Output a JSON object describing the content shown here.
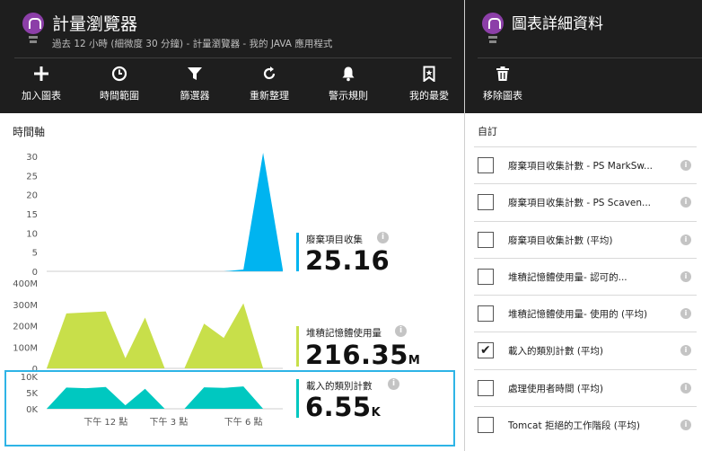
{
  "left_blade": {
    "title": "計量瀏覽器",
    "subtitle": "過去 12 小時 (細微度 30 分鐘) - 計量瀏覽器 - 我的 JAVA 應用程式",
    "toolbar": [
      {
        "icon": "plus-icon",
        "label": "加入圖表"
      },
      {
        "icon": "clock-icon",
        "label": "時間範圍"
      },
      {
        "icon": "filter-icon",
        "label": "篩選器"
      },
      {
        "icon": "refresh-icon",
        "label": "重新整理"
      },
      {
        "icon": "bell-icon",
        "label": "警示規則"
      },
      {
        "icon": "bookmark-icon",
        "label": "我的最愛"
      }
    ],
    "section_title": "時間軸"
  },
  "right_blade": {
    "title": "圖表詳細資料",
    "toolbar": [
      {
        "icon": "trash-icon",
        "label": "移除圖表"
      }
    ],
    "custom_label": "自訂",
    "metrics": [
      {
        "label": "廢棄項目收集計數 - PS MarkSw...",
        "checked": false
      },
      {
        "label": "廢棄項目收集計數 - PS Scaven...",
        "checked": false
      },
      {
        "label": "廢棄項目收集計數 (平均)",
        "checked": false
      },
      {
        "label": "堆積記憶體使用量- 認可的...",
        "checked": false
      },
      {
        "label": "堆積記憶體使用量- 使用的 (平均)",
        "checked": false
      },
      {
        "label": "載入的類別計數 (平均)",
        "checked": true
      },
      {
        "label": "處理使用者時間 (平均)",
        "checked": false
      },
      {
        "label": "Tomcat 拒絕的工作階段 (平均)",
        "checked": false
      }
    ]
  },
  "summaries": [
    {
      "name": "廢棄項目收集",
      "value": "25.16",
      "unit": "",
      "color": "#00b4f0"
    },
    {
      "name": "堆積記憶體使用量",
      "value": "216.35",
      "unit": "M",
      "color": "#c8df4a"
    },
    {
      "name": "載入的類別計數",
      "value": "6.55",
      "unit": "K",
      "color": "#00c8c0"
    }
  ],
  "chart_data": [
    {
      "type": "area",
      "name": "廢棄項目收集",
      "color": "#00b4f0",
      "yticks": [
        "30",
        "25",
        "20",
        "15",
        "10",
        "5",
        "0"
      ],
      "ylim": [
        0,
        32
      ],
      "x": [
        0,
        1,
        2,
        3,
        4,
        5,
        6,
        7,
        8,
        9,
        10,
        11,
        12
      ],
      "values": [
        0,
        0,
        0,
        0,
        0,
        0,
        0,
        0,
        0,
        0,
        0.5,
        33,
        0.5
      ]
    },
    {
      "type": "area",
      "name": "堆積記憶體使用量",
      "color": "#c8df4a",
      "yticks": [
        "400M",
        "300M",
        "200M",
        "100M",
        "0"
      ],
      "ylim": [
        0,
        420
      ],
      "x": [
        0,
        1,
        2,
        3,
        4,
        5,
        6,
        7,
        8,
        9,
        10,
        11,
        12
      ],
      "values": [
        0,
        270,
        275,
        280,
        50,
        250,
        0,
        0,
        220,
        150,
        320,
        0,
        0
      ]
    },
    {
      "type": "area",
      "name": "載入的類別計數",
      "color": "#00c8c0",
      "yticks": [
        "10K",
        "5K",
        "0K"
      ],
      "ylim": [
        0,
        11
      ],
      "x": [
        0,
        1,
        2,
        3,
        4,
        5,
        6,
        7,
        8,
        9,
        10,
        11,
        12
      ],
      "values": [
        0,
        7.2,
        7.0,
        7.4,
        1.2,
        6.8,
        0,
        0,
        7.3,
        7.1,
        7.6,
        0,
        0
      ],
      "xticks": [
        "下午 12 點",
        "下午 3 點",
        "下午 6 點"
      ]
    }
  ]
}
